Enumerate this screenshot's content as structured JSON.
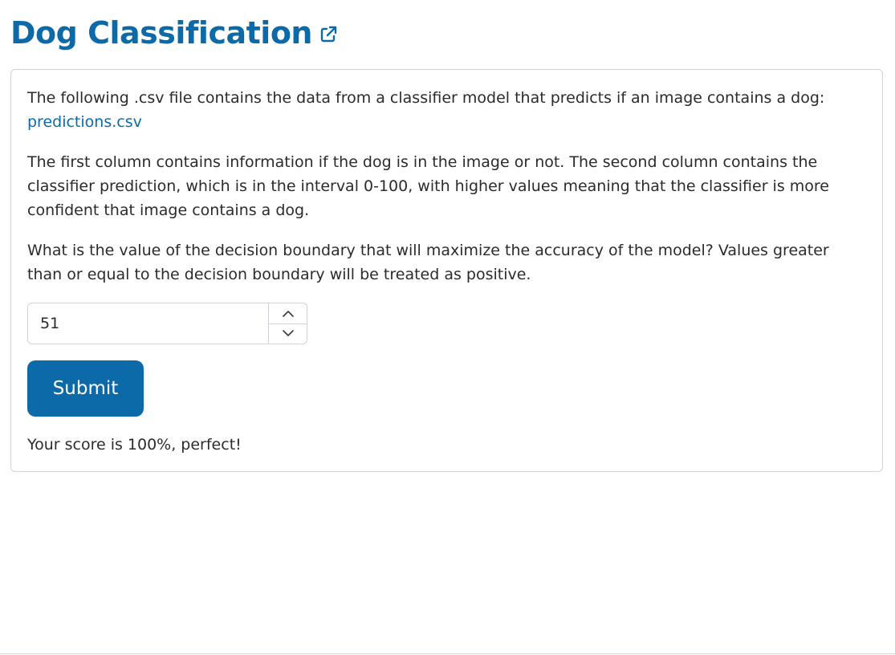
{
  "page": {
    "title": "Dog Classification",
    "title_link_icon": "external-link-icon"
  },
  "content": {
    "intro_text": "The following .csv file contains the data from a classifier model that predicts if an image contains a dog: ",
    "file_link_label": "predictions.csv",
    "column_description": "The first column contains information if the dog is in the image or not. The second column contains the classifier prediction, which is in the interval 0-100, with higher values meaning that the classifier is more confident that image contains a dog.",
    "question": "What is the value of the decision boundary that will maximize the accuracy of the model? Values greater than or equal to the decision boundary will be treated as positive."
  },
  "form": {
    "boundary_value": "51",
    "increment_icon": "chevron-up-icon",
    "decrement_icon": "chevron-down-icon",
    "submit_label": "Submit"
  },
  "result": {
    "message": "Your score is 100%, perfect!"
  },
  "colors": {
    "accent": "#0d6aa8",
    "border": "#cfd4da",
    "text": "#2b2b2b"
  }
}
